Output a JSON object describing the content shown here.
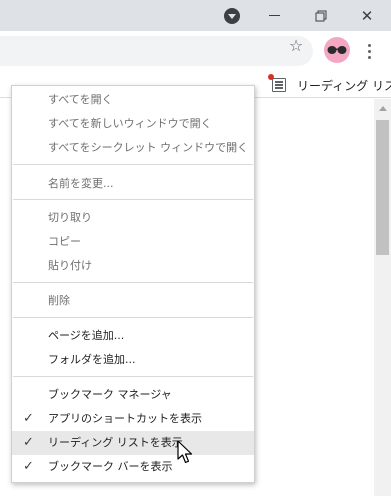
{
  "window": {
    "profile_icon": "profile-menu-icon",
    "minimize_icon": "minimize-icon",
    "restore_icon": "restore-icon",
    "close_icon": "close-icon",
    "close_glyph": "✕"
  },
  "toolbar": {
    "star_icon": "bookmark-star-icon",
    "star_glyph": "☆",
    "avatar_icon": "user-avatar-icon",
    "menu_icon": "kebab-menu-icon"
  },
  "bookmarks_bar": {
    "reading_list_label": "リーディング リスト",
    "reading_list_icon": "reading-list-icon"
  },
  "context_menu": {
    "groups": [
      {
        "items": [
          {
            "label": "すべてを開く",
            "enabled": false
          },
          {
            "label": "すべてを新しいウィンドウで開く",
            "enabled": false
          },
          {
            "label": "すべてをシークレット ウィンドウで開く",
            "enabled": false
          }
        ]
      },
      {
        "items": [
          {
            "label": "名前を変更...",
            "enabled": false
          }
        ]
      },
      {
        "items": [
          {
            "label": "切り取り",
            "enabled": false
          },
          {
            "label": "コピー",
            "enabled": false
          },
          {
            "label": "貼り付け",
            "enabled": false
          }
        ]
      },
      {
        "items": [
          {
            "label": "削除",
            "enabled": false
          }
        ]
      },
      {
        "items": [
          {
            "label": "ページを追加...",
            "enabled": true
          },
          {
            "label": "フォルダを追加...",
            "enabled": true
          }
        ]
      },
      {
        "items": [
          {
            "label": "ブックマーク マネージャ",
            "enabled": true
          },
          {
            "label": "アプリのショートカットを表示",
            "enabled": true,
            "checked": true
          },
          {
            "label": "リーディング リストを表示",
            "enabled": true,
            "checked": true,
            "hovered": true
          },
          {
            "label": "ブックマーク バーを表示",
            "enabled": true,
            "checked": true
          }
        ]
      }
    ],
    "check_glyph": "✓"
  },
  "colors": {
    "titlebar": "#dee1e6",
    "menu_hover": "#e8e8e8",
    "disabled_text": "#6e6e6e",
    "reading_list_dot": "#d93025",
    "avatar_bg": "#f4a7c3"
  }
}
